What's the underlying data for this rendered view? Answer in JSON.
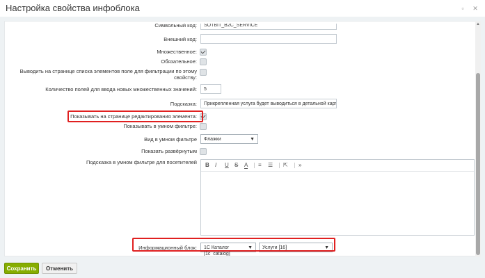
{
  "window": {
    "title": "Настройка свойства инфоблока",
    "min_glyph": "▫",
    "close_glyph": "✕"
  },
  "form": {
    "code_label": "Символьный код:",
    "code_value": "SOTBIT_B2C_SERVICE",
    "ext_code_label": "Внешний код:",
    "ext_code_value": "",
    "multiple_label": "Множественное:",
    "multiple_checked": true,
    "required_label": "Обязательное:",
    "required_checked": false,
    "filter_label": "Выводить на странице списка элементов поле для фильтрации по этому свойству:",
    "filter_checked": false,
    "multi_count_label": "Количество полей для ввода новых множественных значений:",
    "multi_count_value": "5",
    "hint_label": "Подсказка:",
    "hint_value": "Прикрепленная услуга будет выводиться в детальной карточке",
    "show_edit_label": "Показывать на странице редактирования элемента:",
    "show_edit_checked": true,
    "smart_filter_label": "Показывать в умном фильтре:",
    "smart_filter_checked": false,
    "smart_view_label": "Вид в умном фильтре",
    "smart_view_value": "Флажки",
    "expanded_label": "Показать развёрнутым",
    "expanded_checked": false,
    "smart_hint_label": "Подсказка в умном фильтре для посетителей",
    "iblock_label": "Информационный блок:",
    "iblock_type_value": "1C Каталог [1c_catalog]",
    "iblock_value": "Услуги [16]"
  },
  "editor_toolbar": [
    "B",
    "I",
    "U",
    "S",
    "A",
    "≡",
    "☰",
    "⇱",
    "»"
  ],
  "footer": {
    "save_label": "Сохранить",
    "cancel_label": "Отменить"
  },
  "colors": {
    "save_bg": "#86ad00",
    "highlight": "#e02020"
  }
}
